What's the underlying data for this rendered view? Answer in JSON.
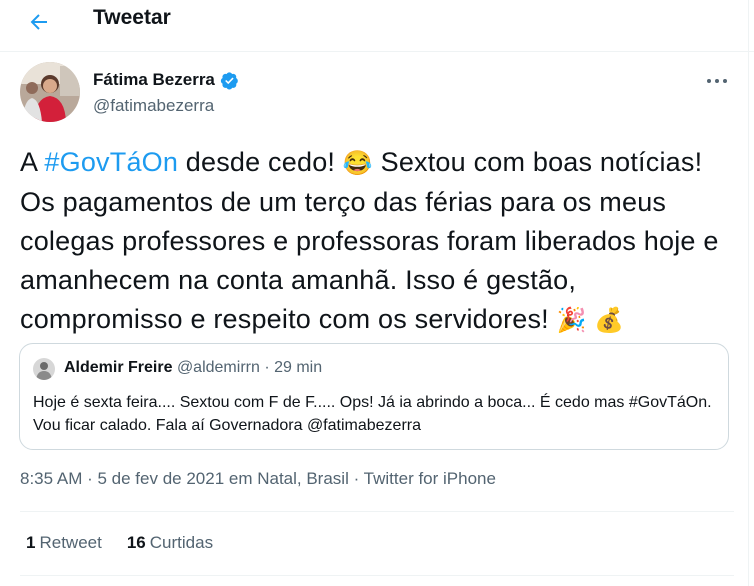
{
  "header": {
    "title": "Tweetar",
    "back_icon": "arrow-left-icon"
  },
  "author": {
    "name": "Fátima Bezerra",
    "handle": "@fatimabezerra",
    "verified_icon": "verified-badge-icon"
  },
  "menu": {
    "more_icon": "more-horizontal-icon"
  },
  "tweet": {
    "text_start": "A ",
    "hashtag": "#GovTáOn",
    "text_mid": " desde cedo! ",
    "emoji_laugh": "😂",
    "text_rest": " Sextou com boas notícias! Os pagamentos de um terço das férias para os meus colegas professores e professoras foram liberados hoje e amanhecem na conta amanhã. Isso é gestão, compromisso e respeito com os servidores! ",
    "emoji_party": "🎉",
    "emoji_money": "💰"
  },
  "quote": {
    "name": "Aldemir Freire",
    "meta": "@aldemirrn · 29 min",
    "text": "Hoje é sexta feira....  Sextou com F de F..... Ops! Já ia abrindo a boca... É cedo mas #GovTáOn. Vou ficar calado. Fala aí Governadora @fatimabezerra"
  },
  "meta": {
    "time": "8:35 AM",
    "date": "5 de fev de 2021 em Natal, Brasil",
    "source": "Twitter for iPhone",
    "dot": " · "
  },
  "stats": {
    "retweets_count": "1",
    "retweets_label": "Retweet",
    "likes_count": "16",
    "likes_label": "Curtidas"
  },
  "colors": {
    "accent": "#1d9bf0",
    "text": "#0f1419",
    "muted": "#536471",
    "border": "#cfd9de"
  }
}
